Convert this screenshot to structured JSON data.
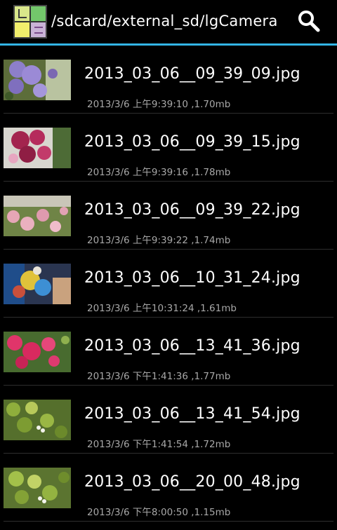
{
  "header": {
    "path": "/sdcard/external_sd/lgCamera",
    "icon": "file-manager-icon",
    "search_icon": "search-icon",
    "accent_color": "#33b5e5"
  },
  "files": [
    {
      "name": "2013_03_06__09_39_09.jpg",
      "meta": "2013/3/6 上午9:39:10  ,1.70mb",
      "thumb": "purple-flowers"
    },
    {
      "name": "2013_03_06__09_39_15.jpg",
      "meta": "2013/3/6 上午9:39:16  ,1.78mb",
      "thumb": "pink-orchid"
    },
    {
      "name": "2013_03_06__09_39_22.jpg",
      "meta": "2013/3/6 上午9:39:22  ,1.74mb",
      "thumb": "pink-roses"
    },
    {
      "name": "2013_03_06__10_31_24.jpg",
      "meta": "2013/3/6 上午10:31:24  ,1.61mb",
      "thumb": "colorful-object"
    },
    {
      "name": "2013_03_06__13_41_36.jpg",
      "meta": "2013/3/6 下午1:41:36  ,1.77mb",
      "thumb": "red-bougainvillea"
    },
    {
      "name": "2013_03_06__13_41_54.jpg",
      "meta": "2013/3/6 下午1:41:54  ,1.72mb",
      "thumb": "green-leaves"
    },
    {
      "name": "2013_03_06__20_00_48.jpg",
      "meta": "2013/3/6 下午8:00:50  ,1.15mb",
      "thumb": "green-leaves-2"
    }
  ]
}
